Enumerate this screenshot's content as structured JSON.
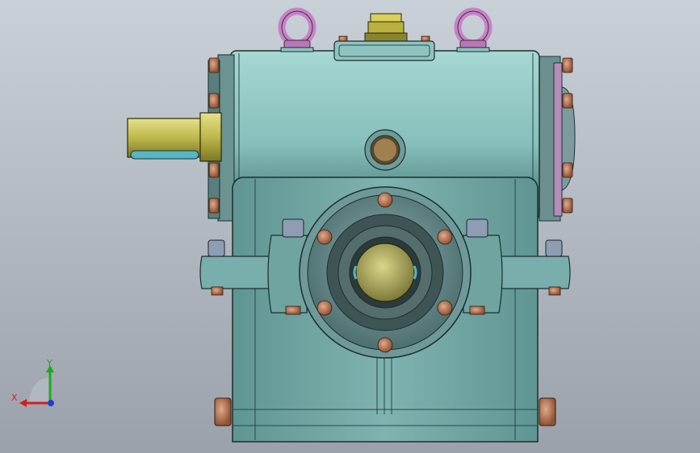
{
  "view": {
    "background_top": "#c9d0d8",
    "background_bottom": "#9aa1aa"
  },
  "model": {
    "housing_color": "#7fb7b3",
    "housing_dark": "#4f7f7e",
    "bolt_color": "#c9896a",
    "nut_color": "#8c9bb2",
    "lifting_eye_color": "#c583c4",
    "shaft_color": "#c7c45a",
    "seal_color": "#a8b8a0"
  },
  "triad": {
    "x_label": "X",
    "y_label": "Y",
    "x_color": "#d11f1f",
    "y_color": "#1fa81f",
    "z_color": "#1f3fd1"
  }
}
